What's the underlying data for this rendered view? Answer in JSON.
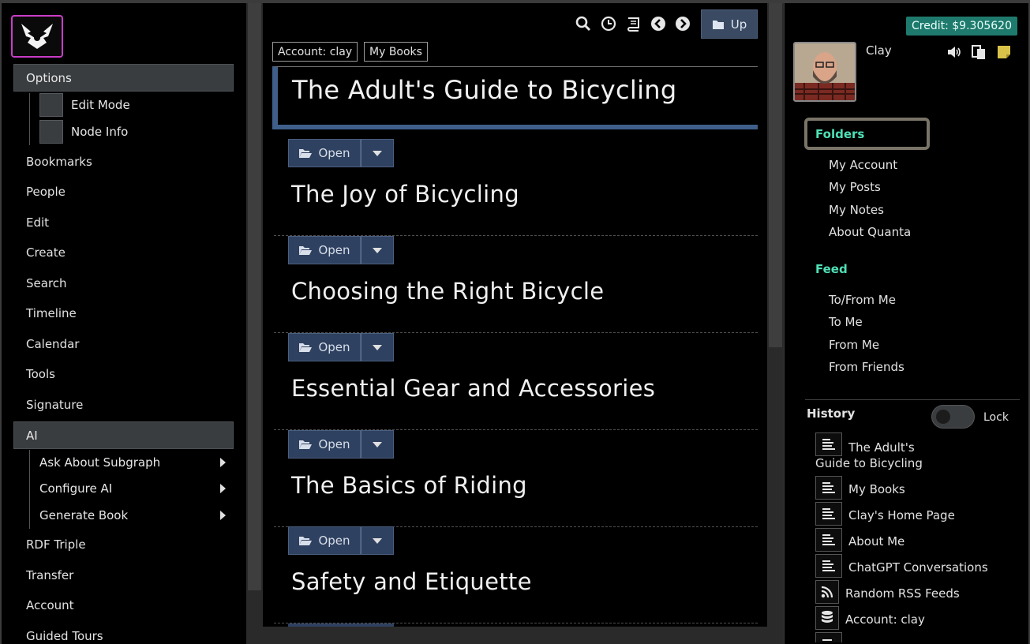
{
  "left_menu": {
    "options": {
      "label": "Options",
      "items": [
        "Edit Mode",
        "Node Info"
      ]
    },
    "items": [
      "Bookmarks",
      "People",
      "Edit",
      "Create",
      "Search",
      "Timeline",
      "Calendar",
      "Tools",
      "Signature"
    ],
    "ai": {
      "label": "AI",
      "items": [
        "Ask About Subgraph",
        "Configure AI",
        "Generate Book"
      ]
    },
    "bottom_items": [
      "RDF Triple",
      "Transfer",
      "Account",
      "Guided Tours"
    ]
  },
  "toolbar": {
    "up_label": "Up"
  },
  "breadcrumbs": [
    "Account: clay",
    "My Books"
  ],
  "page_title": "The Adult's Guide to Bicycling",
  "nodes": [
    {
      "open_label": "Open",
      "title": "The Joy of Bicycling"
    },
    {
      "open_label": "Open",
      "title": "Choosing the Right Bicycle"
    },
    {
      "open_label": "Open",
      "title": "Essential Gear and Accessories"
    },
    {
      "open_label": "Open",
      "title": "The Basics of Riding"
    },
    {
      "open_label": "Open",
      "title": "Safety and Etiquette"
    }
  ],
  "right": {
    "credit": "Credit: $9.305620",
    "username": "Clay",
    "folders": {
      "label": "Folders",
      "items": [
        "My Account",
        "My Posts",
        "My Notes",
        "About Quanta"
      ]
    },
    "feed": {
      "label": "Feed",
      "items": [
        "To/From Me",
        "To Me",
        "From Me",
        "From Friends"
      ]
    },
    "history": {
      "label": "History",
      "lock_label": "Lock",
      "items": [
        {
          "label": "The Adult's",
          "label2": "Guide to Bicycling",
          "icon": "doc-icon"
        },
        {
          "label": "My Books",
          "icon": "doc-icon"
        },
        {
          "label": "Clay's Home Page",
          "icon": "doc-icon"
        },
        {
          "label": "About Me",
          "icon": "doc-icon"
        },
        {
          "label": "ChatGPT Conversations",
          "icon": "doc-icon"
        },
        {
          "label": "Random RSS Feeds",
          "icon": "rss-icon"
        },
        {
          "label": "Account: clay",
          "icon": "database-icon"
        }
      ]
    }
  },
  "colors": {
    "accent_teal": "#4fe0b6",
    "credit_bg": "#1f7a6e",
    "button_blue": "#2f4160",
    "logo_border": "#c93cc8"
  }
}
